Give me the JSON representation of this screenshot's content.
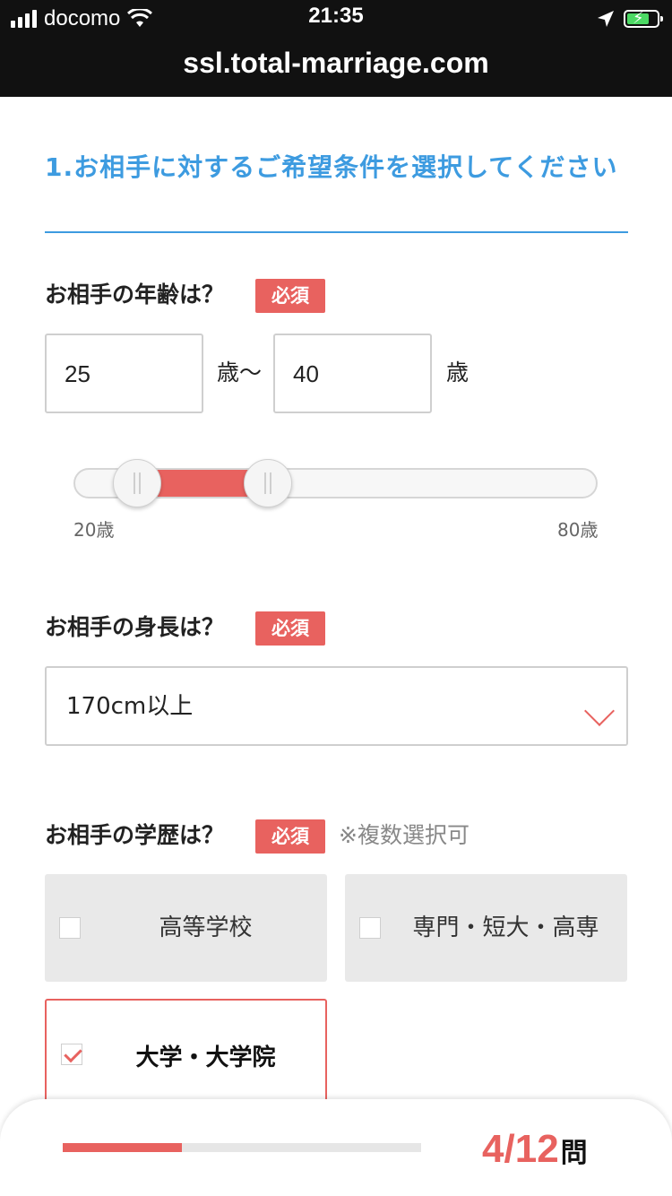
{
  "status_bar": {
    "carrier": "docomo",
    "time": "21:35",
    "url": "ssl.total-marriage.com"
  },
  "section": {
    "title": "1.お相手に対するご希望条件を選択してください"
  },
  "age": {
    "label": "お相手の年齢は？",
    "required": "必須",
    "min_value": "25",
    "max_value": "40",
    "sep_unit": "歳〜",
    "end_unit": "歳",
    "slider": {
      "range_min": 20,
      "range_max": 80,
      "selected_min": 25,
      "selected_max": 40,
      "min_label": "20歳",
      "max_label": "80歳"
    }
  },
  "height": {
    "label": "お相手の身長は？",
    "required": "必須",
    "selected": "170cm以上"
  },
  "education": {
    "label": "お相手の学歴は？",
    "required": "必須",
    "note": "※複数選択可",
    "options": [
      {
        "label": "高等学校",
        "checked": false
      },
      {
        "label": "専門・短大・高専",
        "checked": false
      },
      {
        "label": "大学・大学院",
        "checked": true
      }
    ]
  },
  "progress": {
    "current": "4",
    "separator": "/",
    "total": "12",
    "unit": "問",
    "fraction": 0.333
  },
  "colors": {
    "accent": "#e8625f",
    "title_blue": "#3d9be0"
  }
}
